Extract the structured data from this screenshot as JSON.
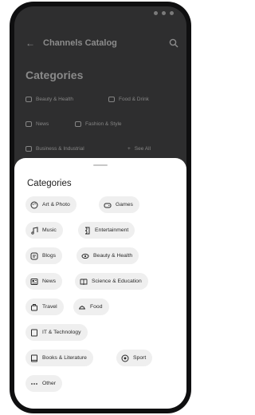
{
  "background": {
    "app_title": "Channels Catalog",
    "heading": "Categories",
    "chips": [
      {
        "label": "Beauty & Health",
        "icon": "eye-icon"
      },
      {
        "label": "Food & Drink",
        "icon": "dish-icon"
      },
      {
        "label": "News",
        "icon": "newspaper-icon"
      },
      {
        "label": "Fashion & Style",
        "icon": "hanger-icon"
      },
      {
        "label": "Business & Industrial",
        "icon": "briefcase-icon"
      },
      {
        "label": "See All",
        "icon": "plus-icon"
      }
    ]
  },
  "sheet": {
    "title": "Categories",
    "chips": [
      {
        "label": "Art & Photo",
        "icon": "palette-icon"
      },
      {
        "label": "Games",
        "icon": "gamepad-icon"
      },
      {
        "label": "Music",
        "icon": "music-note-icon"
      },
      {
        "label": "Entertainment",
        "icon": "ticket-icon"
      },
      {
        "label": "Blogs",
        "icon": "blog-icon"
      },
      {
        "label": "Beauty & Health",
        "icon": "eye-icon"
      },
      {
        "label": "News",
        "icon": "newspaper-icon"
      },
      {
        "label": "Science & Education",
        "icon": "book-icon"
      },
      {
        "label": "Travel",
        "icon": "luggage-icon"
      },
      {
        "label": "Food",
        "icon": "dish-icon"
      },
      {
        "label": "IT & Technology",
        "icon": "laptop-icon"
      },
      {
        "label": "Books & Literature",
        "icon": "books-icon"
      },
      {
        "label": "Sport",
        "icon": "ball-icon"
      },
      {
        "label": "Other",
        "icon": "more-icon"
      }
    ]
  },
  "colors": {
    "sheet_bg": "#ffffff",
    "chip_bg": "#efefef",
    "overlay": "#2e2e2f"
  }
}
